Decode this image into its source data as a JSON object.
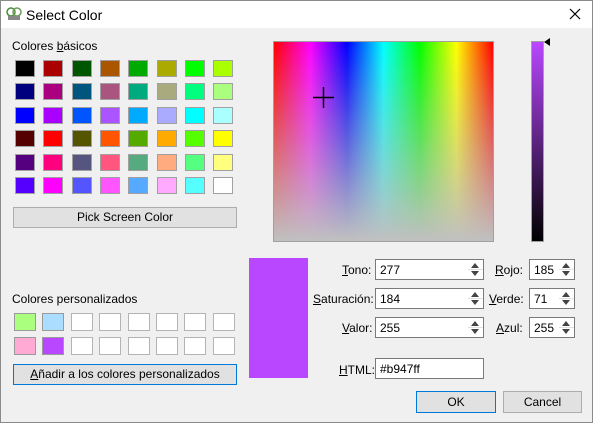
{
  "window": {
    "title": "Select Color",
    "icon": "app-icon",
    "close_icon": "close-icon"
  },
  "basic": {
    "label_pre": "Colores ",
    "label_ul": "b",
    "label_post": "ásicos",
    "colors": [
      [
        "#000000",
        "#aa0000",
        "#005500",
        "#aa5500",
        "#00aa00",
        "#aaaa00",
        "#00ff00",
        "#aaff00"
      ],
      [
        "#00007f",
        "#aa007f",
        "#00557f",
        "#aa557f",
        "#00aa7f",
        "#aaaa7f",
        "#00ff7f",
        "#aaff7f"
      ],
      [
        "#0000ff",
        "#aa00ff",
        "#0055ff",
        "#aa55ff",
        "#00aaff",
        "#aaaaff",
        "#00ffff",
        "#aaffff"
      ],
      [
        "#550000",
        "#ff0000",
        "#555500",
        "#ff5500",
        "#55aa00",
        "#ffaa00",
        "#55ff00",
        "#ffff00"
      ],
      [
        "#55007f",
        "#ff007f",
        "#55557f",
        "#ff557f",
        "#55aa7f",
        "#ffaa7f",
        "#55ff7f",
        "#ffff7f"
      ],
      [
        "#5500ff",
        "#ff00ff",
        "#5555ff",
        "#ff55ff",
        "#55aaff",
        "#ffaaff",
        "#55ffff",
        "#ffffff"
      ]
    ]
  },
  "pick_screen": {
    "label": "Pick Screen Color"
  },
  "custom": {
    "label": "Colores personalizados",
    "rows": [
      [
        "#aaff7f",
        "#aaddff",
        "#ffffff",
        "#ffffff",
        "#ffffff",
        "#ffffff",
        "#ffffff",
        "#ffffff"
      ],
      [
        "#ffaad4",
        "#b947ff",
        "#ffffff",
        "#ffffff",
        "#ffffff",
        "#ffffff",
        "#ffffff",
        "#ffffff"
      ]
    ],
    "add_pre": "",
    "add_ul": "A",
    "add_post": "ñadir a los colores personalizados"
  },
  "current_color": "#b947ff",
  "fields": {
    "tono": {
      "label_ul": "T",
      "label_post": "ono:",
      "value": "277"
    },
    "saturacion": {
      "label_ul": "S",
      "label_post": "aturación:",
      "value": "184"
    },
    "valor": {
      "label_ul": "V",
      "label_post": "alor:",
      "value": "255"
    },
    "rojo": {
      "label_ul": "R",
      "label_post": "ojo:",
      "value": "185"
    },
    "verde": {
      "label_ul": "V",
      "label_post": "erde:",
      "value": "71"
    },
    "azul": {
      "label_ul": "A",
      "label_post": "zul:",
      "value": "255"
    },
    "html": {
      "label_ul": "H",
      "label_post": "TML:",
      "value": "#b947ff"
    }
  },
  "buttons": {
    "ok": "OK",
    "cancel": "Cancel"
  }
}
